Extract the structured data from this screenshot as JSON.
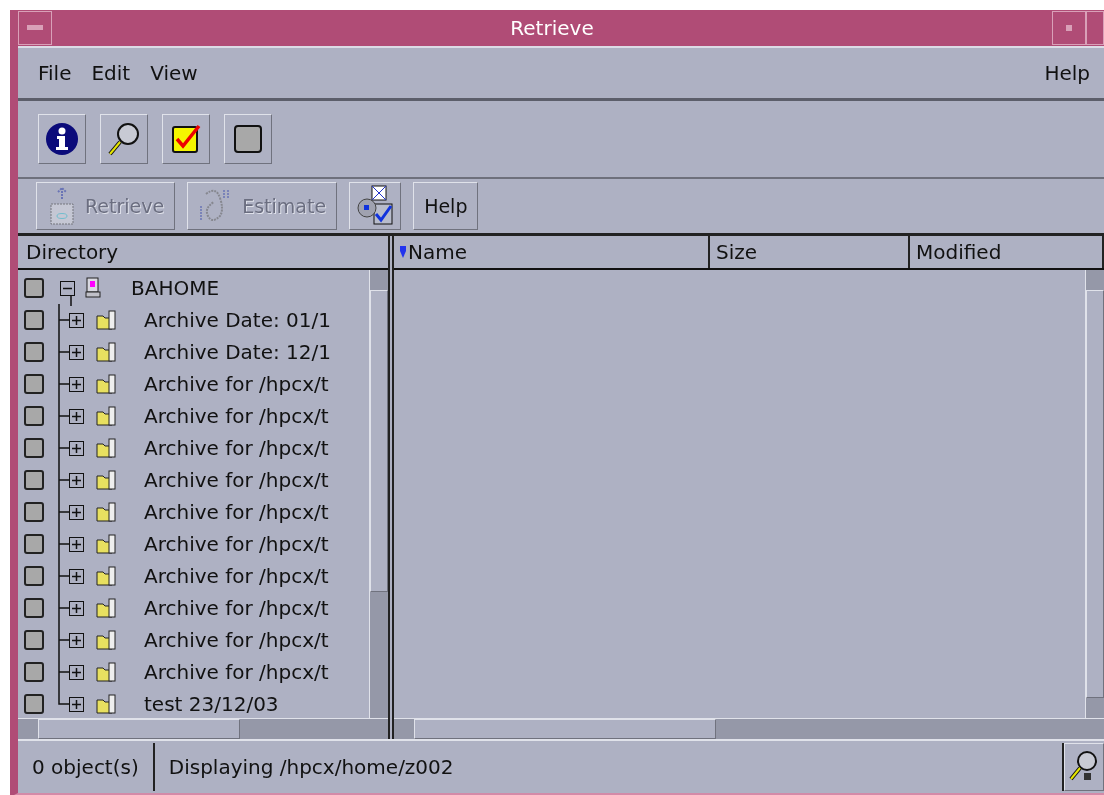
{
  "window": {
    "title": "Retrieve"
  },
  "menu": [
    {
      "label": "File"
    },
    {
      "label": "Edit"
    },
    {
      "label": "View"
    },
    {
      "label": "Help"
    }
  ],
  "toolbar": [
    {
      "kind": "info"
    },
    {
      "kind": "find"
    },
    {
      "kind": "select-all"
    },
    {
      "kind": "deselect"
    }
  ],
  "actions": [
    {
      "kind": "retrieve",
      "label": "Retrieve",
      "disabled": true
    },
    {
      "kind": "estimate",
      "label": "Estimate",
      "disabled": true
    },
    {
      "kind": "options",
      "disabled": false
    },
    {
      "kind": "text",
      "label": "Help",
      "disabled": false
    }
  ],
  "tree": {
    "header": "Directory",
    "root": {
      "label": "BAHOME",
      "checked": false,
      "expanded": true,
      "children": [
        {
          "label": "Archive Date: 01/1",
          "checked": false,
          "expanded": false
        },
        {
          "label": "Archive Date: 12/1",
          "checked": false,
          "expanded": false
        },
        {
          "label": "Archive for /hpcx/t",
          "checked": false,
          "expanded": false
        },
        {
          "label": "Archive for /hpcx/t",
          "checked": false,
          "expanded": false
        },
        {
          "label": "Archive for /hpcx/t",
          "checked": false,
          "expanded": false
        },
        {
          "label": "Archive for /hpcx/t",
          "checked": false,
          "expanded": false
        },
        {
          "label": "Archive for /hpcx/t",
          "checked": false,
          "expanded": false
        },
        {
          "label": "Archive for /hpcx/t",
          "checked": false,
          "expanded": false
        },
        {
          "label": "Archive for /hpcx/t",
          "checked": false,
          "expanded": false
        },
        {
          "label": "Archive for /hpcx/t",
          "checked": false,
          "expanded": false
        },
        {
          "label": "Archive for /hpcx/t",
          "checked": false,
          "expanded": false
        },
        {
          "label": "Archive for /hpcx/t",
          "checked": false,
          "expanded": false
        },
        {
          "label": "test 23/12/03",
          "checked": false,
          "expanded": false
        }
      ]
    }
  },
  "table": {
    "columns": [
      {
        "label": "Name",
        "sorted": true
      },
      {
        "label": "Size",
        "sorted": false
      },
      {
        "label": "Modified",
        "sorted": false
      }
    ]
  },
  "status_bar": {
    "count": "0 object(s)",
    "message": "Displaying /hpcx/home/z002"
  }
}
